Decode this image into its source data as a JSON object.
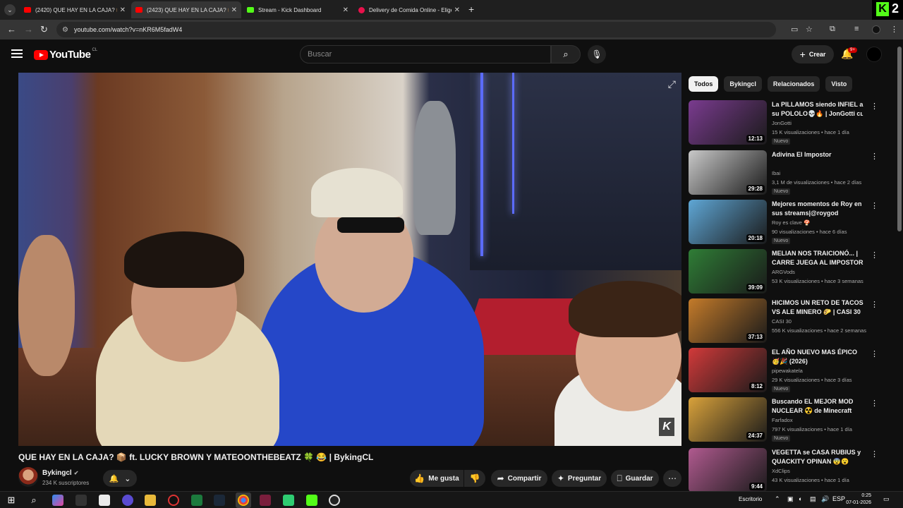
{
  "browser": {
    "tabs": [
      {
        "label": "(2420) QUE HAY EN LA CAJA? 📦",
        "favicon": "youtube-icon",
        "active": false
      },
      {
        "label": "(2423) QUE HAY EN LA CAJA? 📦",
        "favicon": "youtube-icon",
        "active": true
      },
      {
        "label": "Stream - Kick Dashboard",
        "favicon": "kick-icon",
        "active": false
      },
      {
        "label": "Delivery de Comida Online - Elige",
        "favicon": "pedidosya-icon",
        "active": false
      }
    ],
    "corner_badge": "2",
    "url": "youtube.com/watch?v=nKR6M5fadW4"
  },
  "masthead": {
    "logo_text": "YouTube",
    "country_code": "CL",
    "search_placeholder": "Buscar",
    "create_label": "Crear",
    "notification_count": "9+"
  },
  "video": {
    "title": "QUE HAY EN LA CAJA? 📦 ft. LUCKY BROWN Y MATEOONTHEBEATZ 🍀 😂 | BykingCL",
    "channel": "Bykingcl",
    "subscribers": "234 K suscriptores",
    "actions": {
      "like": "Me gusta",
      "share": "Compartir",
      "ask": "Preguntar",
      "save": "Guardar"
    }
  },
  "chips": [
    "Todos",
    "Bykingcl",
    "Relacionados",
    "Visto"
  ],
  "recommendations": [
    {
      "title": "La PILLAMOS siendo INFIEL a su POLOLO💀🔥 | JonGotti cʟ",
      "channel": "JonGotti",
      "meta": "15 K visualizaciones • hace 1 día",
      "badge": "Nuevo",
      "duration": "12:13",
      "thumb": "#7a3b8f"
    },
    {
      "title": "Adivina El Impostor",
      "channel": "Ibai",
      "meta": "3,1 M de visualizaciones • hace 2 días",
      "badge": "Nuevo",
      "duration": "29:28",
      "thumb": "#c9c9c9"
    },
    {
      "title": "Mejores momentos de Roy en sus streams|@roygod",
      "channel": "Roy es clave 🍄",
      "meta": "90 visualizaciones • hace 6 días",
      "badge": "Nuevo",
      "duration": "20:18",
      "thumb": "#5fa7d6"
    },
    {
      "title": "MELIAN NOS TRAICIONÓ... | CARRE JUEGA AL IMPOSTOR",
      "channel": "ARGVods",
      "meta": "53 K visualizaciones • hace 3 semanas",
      "badge": "",
      "duration": "39:09",
      "thumb": "#2f7d36"
    },
    {
      "title": "HICIMOS UN RETO DE TACOS VS ALE MINERO 🌮 | CASI 30",
      "channel": "CASI 30",
      "meta": "556 K visualizaciones • hace 2 semanas",
      "badge": "",
      "duration": "37:13",
      "thumb": "#c47b2a"
    },
    {
      "title": "EL AÑO NUEVO MAS ÉPICO 🥳🎉 (2026)",
      "channel": "pipewakatela",
      "meta": "29 K visualizaciones • hace 3 días",
      "badge": "Nuevo",
      "duration": "8:12",
      "thumb": "#d23a3a"
    },
    {
      "title": "Buscando EL MEJOR MOD NUCLEAR ☢️ de Minecraft",
      "channel": "Farfadox",
      "meta": "797 K visualizaciones • hace 1 día",
      "badge": "Nuevo",
      "duration": "24:37",
      "thumb": "#d9a23b"
    },
    {
      "title": "VEGETTA se CASA RUBIUS y QUACKITY OPINAN 😨😮",
      "channel": "XdClips",
      "meta": "43 K visualizaciones • hace 1 día",
      "badge": "",
      "duration": "9:44",
      "thumb": "#b05a8f"
    }
  ],
  "taskbar": {
    "lang": "Escritorio",
    "locale": "ESP",
    "time": "0:25",
    "date": "07-01-2026"
  }
}
